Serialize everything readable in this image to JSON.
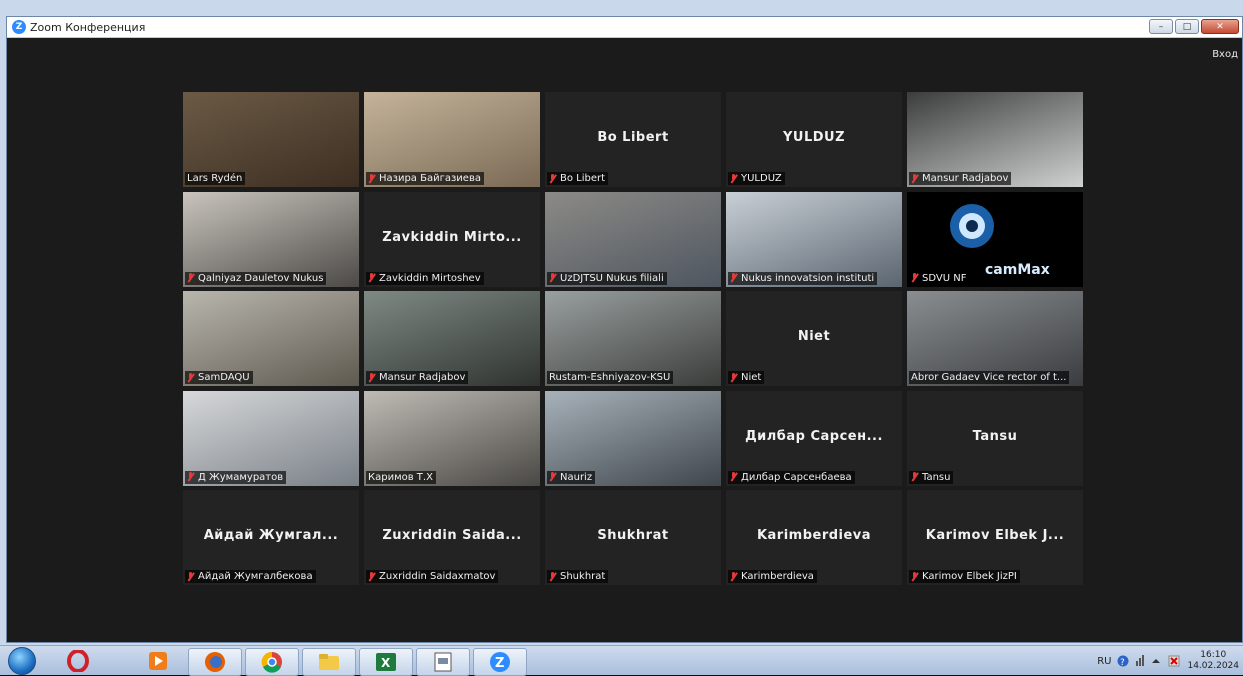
{
  "window": {
    "title": "Zoom Конференция",
    "login_label": "Вход"
  },
  "window_buttons": {
    "minimize": "–",
    "maximize": "□",
    "close": "✕"
  },
  "tiles": [
    {
      "name": "Lars Rydén",
      "muted": false,
      "has_video": true
    },
    {
      "name": "Назира Байгазиева",
      "muted": true,
      "has_video": true
    },
    {
      "name": "Bo Libert",
      "center": "Bo Libert",
      "muted": true,
      "has_video": false
    },
    {
      "name": "YULDUZ",
      "center": "YULDUZ",
      "muted": true,
      "has_video": false
    },
    {
      "name": "Mansur Radjabov",
      "muted": true,
      "has_video": true
    },
    {
      "name": "Qalniyaz Dauletov Nukus",
      "muted": true,
      "has_video": true
    },
    {
      "name": "Zavkiddin Mirtoshev",
      "center": "Zavkiddin  Mirto...",
      "muted": true,
      "has_video": false
    },
    {
      "name": "UzDJTSU Nukus filiali",
      "muted": true,
      "has_video": true
    },
    {
      "name": "Nukus innovatsion instituti",
      "muted": true,
      "has_video": true
    },
    {
      "name": "SDVU NF",
      "overlay": "camMax",
      "muted": true,
      "has_video": true
    },
    {
      "name": "SamDAQU",
      "muted": true,
      "has_video": true
    },
    {
      "name": "Mansur Radjabov",
      "muted": true,
      "has_video": true
    },
    {
      "name": "Rustam-Eshniyazov-KSU",
      "muted": false,
      "has_video": true
    },
    {
      "name": "Niet",
      "center": "Niet",
      "muted": true,
      "has_video": false
    },
    {
      "name": "Abror Gadaev Vice rector of t...",
      "muted": false,
      "has_video": true
    },
    {
      "name": "Д Жумамуратов",
      "muted": true,
      "has_video": true
    },
    {
      "name": "Каримов Т.Х",
      "muted": false,
      "has_video": true
    },
    {
      "name": "Nauriz",
      "muted": true,
      "has_video": true,
      "active_speaker": true
    },
    {
      "name": "Дилбар Сарсенбаева",
      "center": "Дилбар  Сарсен...",
      "muted": true,
      "has_video": false
    },
    {
      "name": "Tansu",
      "center": "Tansu",
      "muted": true,
      "has_video": false
    },
    {
      "name": "Айдай Жумгалбекова",
      "center": "Айдай  Жумгал...",
      "muted": true,
      "has_video": false
    },
    {
      "name": "Zuxriddin Saidaxmatov",
      "center": "Zuxriddin  Saida...",
      "muted": true,
      "has_video": false
    },
    {
      "name": "Shukhrat",
      "center": "Shukhrat",
      "muted": true,
      "has_video": false
    },
    {
      "name": "Karimberdieva",
      "center": "Karimberdieva",
      "muted": true,
      "has_video": false
    },
    {
      "name": "Karimov Elbek JizPI",
      "center": "Karimov  Elbek  J...",
      "muted": true,
      "has_video": false
    }
  ],
  "taskbar": {
    "apps": [
      "opera-icon",
      "media-player-icon",
      "firefox-icon",
      "chrome-icon",
      "file-explorer-icon",
      "excel-icon",
      "document-icon",
      "zoom-icon"
    ],
    "excel_glyph": "X",
    "zoom_glyph": "Z"
  },
  "tray": {
    "language": "RU",
    "time": "16:10",
    "date": "14.02.2024"
  },
  "colors": {
    "active_speaker_border": "#d7e25c",
    "muted_mic": "#e43a3a",
    "zoom_blue": "#2d8cff"
  }
}
